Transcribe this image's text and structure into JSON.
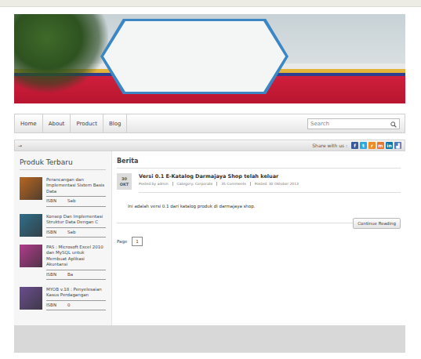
{
  "nav": {
    "items": [
      {
        "label": "Home",
        "selected": false
      },
      {
        "label": "About",
        "selected": false
      },
      {
        "label": "Product",
        "selected": false
      },
      {
        "label": "Blog",
        "selected": false
      }
    ]
  },
  "search": {
    "placeholder": "Search"
  },
  "toolbar": {
    "arrow": "→",
    "share_label": "Share with us :",
    "share": [
      {
        "glyph": "f",
        "color": "#3b5998"
      },
      {
        "glyph": "t",
        "color": "#2aa9e0"
      },
      {
        "glyph": "r",
        "color": "#f08a24"
      },
      {
        "glyph": "m",
        "color": "#e8772e"
      },
      {
        "glyph": "in",
        "color": "#0e76a8"
      },
      {
        "glyph": "▟",
        "color": "#4a7bbf"
      }
    ]
  },
  "sidebar": {
    "title": "Produk Terbaru",
    "products": [
      {
        "title": "Perancangan dan Implementasi Sistem Basis Data",
        "isbn_label": "ISBN",
        "isbn": "Sab",
        "color": "#b8661f"
      },
      {
        "title": "Konsep Dan Implementasi Struktur Data Dengan C",
        "isbn_label": "ISBN",
        "isbn": "Sab",
        "color": "#2f6f8a"
      },
      {
        "title": "PAS : Microsoft Excel 2010 dan MySQL untuk Membuat Aplikasi Akuntansi",
        "isbn_label": "ISBN",
        "isbn": "Ba",
        "color": "#b23a8c"
      },
      {
        "title": "MYOB v.18 : Penyelesaian Kasus Perdagangan",
        "isbn_label": "ISBN",
        "isbn": "0",
        "color": "#6a4d8f"
      }
    ]
  },
  "content": {
    "title": "Berita",
    "post": {
      "day": "30",
      "month": "OKT",
      "title": "Versi 0.1 E-Katalog Darmajaya Shop telah keluar",
      "meta": [
        "Posted by admin",
        "Category: Corporate",
        "35 Comments",
        "Posted: 30 Oktober 2013"
      ],
      "body": "Ini adalah versi 0.1 dari katalog produk di darmajaya shop.",
      "button": "Continue Reading"
    },
    "pagination": {
      "label": "Page",
      "pages": [
        {
          "label": "1",
          "selected": true
        }
      ]
    }
  }
}
